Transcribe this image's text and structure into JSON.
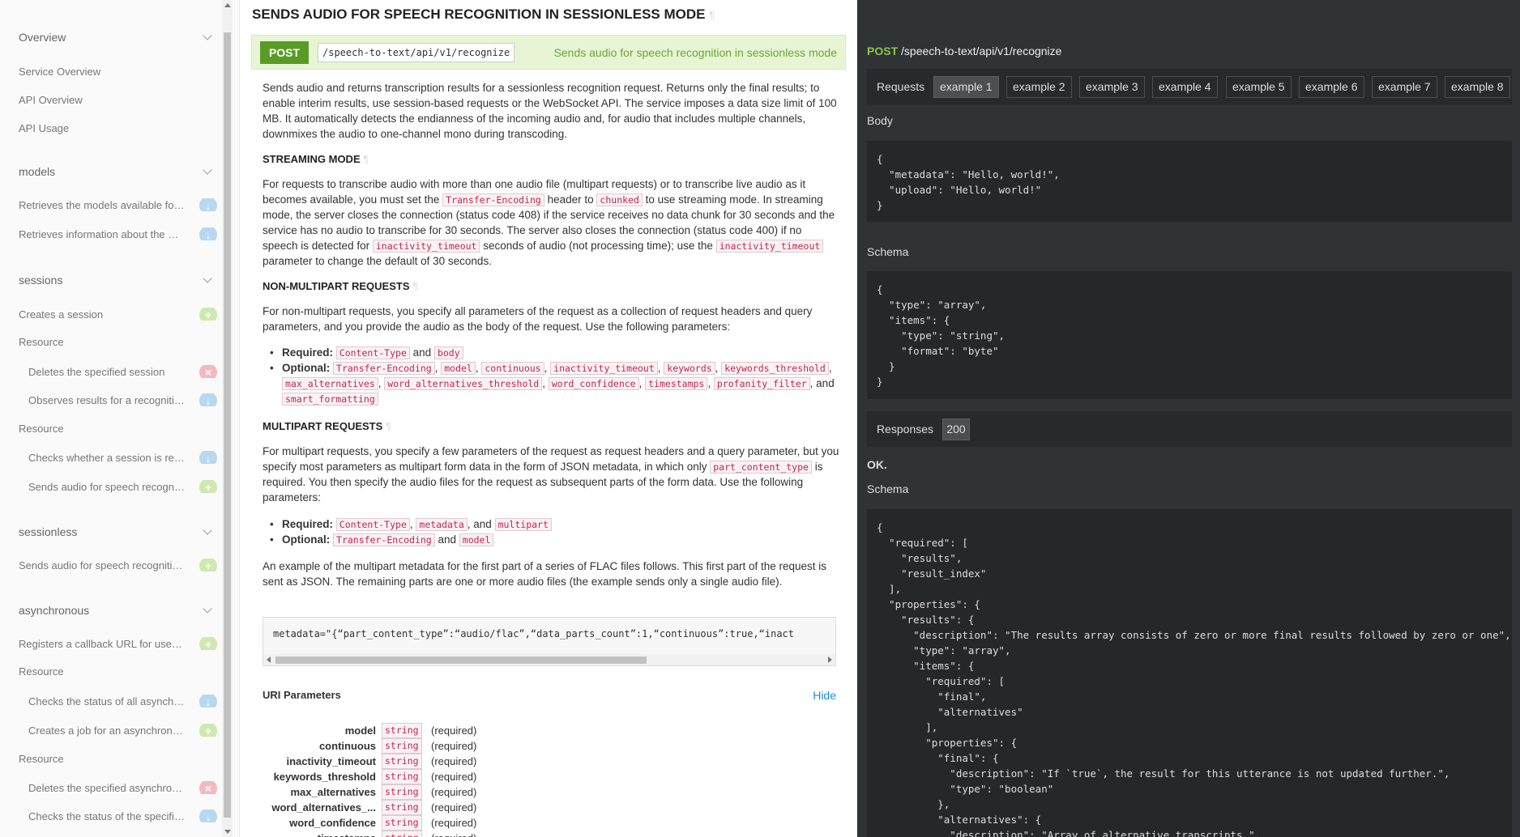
{
  "sidebar": {
    "groups": [
      {
        "title": "Overview",
        "items": [
          "Service Overview",
          "API Overview",
          "API Usage"
        ]
      },
      {
        "title": "models",
        "items": [
          "Retrieves the models available for the service",
          "Retrieves information about the model"
        ]
      },
      {
        "title": "sessions",
        "items": [
          "Creates a session",
          "Deletes the specified session",
          "Observes results for a recognition",
          "Checks whether a session is ready",
          "Sends audio for speech recognition"
        ]
      },
      {
        "title": "sessionless",
        "items": [
          "Sends audio for speech recognition in sessionless mode"
        ]
      },
      {
        "title": "asynchronous",
        "items": [
          "Registers a callback URL for use with",
          "Checks the status of all asynchronous",
          "Creates a job for an asynchronous",
          "Deletes the specified asynchronous",
          "Checks the status of the specified"
        ]
      }
    ],
    "resource_label": "Resource",
    "badge_get": "↓",
    "badge_post": "+",
    "badge_delete": "×"
  },
  "main": {
    "title": "SENDS AUDIO FOR SPEECH RECOGNITION IN SESSIONLESS MODE",
    "pilcrow": "¶",
    "method": "POST",
    "path": "/speech-to-text/api/v1/recognize",
    "summary": "Sends audio for speech recognition in sessionless mode",
    "intro": "Sends audio and returns transcription results for a sessionless recognition request. Returns only the final results; to enable interim results, use session-based requests or the WebSocket API. The service imposes a data size limit of 100 MB. It automatically detects the endianness of the incoming audio and, for audio that includes multiple channels, downmixes the audio to one-channel mono during transcoding.",
    "streaming_heading": "STREAMING MODE",
    "streaming_p1": "For requests to transcribe audio with more than one audio file (multipart requests) or to transcribe live audio as it becomes available, you must set the",
    "streaming_code1": "Transfer-Encoding",
    "streaming_p2": "header to",
    "streaming_code2": "chunked",
    "streaming_p3": "to use streaming mode. In streaming mode, the server closes the connection (status code 408) if the service receives no data chunk for 30 seconds and the service has no audio to transcribe for 30 seconds. The server also closes the connection (status code 400) if no speech is detected for",
    "streaming_code3": "inactivity_timeout",
    "streaming_p4": "seconds of audio (not processing time); use the",
    "streaming_code4": "inactivity_timeout",
    "streaming_p5": "parameter to change the default of 30 seconds.",
    "nonmulti_heading": "NON-MULTIPART REQUESTS",
    "nonmulti_p": "For non-multipart requests, you specify all parameters of the request as a collection of request headers and query parameters, and you provide the audio as the body of the request. Use the following parameters:",
    "required_label": "Required:",
    "optional_label": "Optional:",
    "and": "and",
    "comma_and": ", and",
    "nonmulti_required": [
      "Content-Type",
      "body"
    ],
    "nonmulti_optional": [
      "Transfer-Encoding",
      "model",
      "continuous",
      "inactivity_timeout",
      "keywords",
      "keywords_threshold",
      "max_alternatives",
      "word_alternatives_threshold",
      "word_confidence",
      "timestamps",
      "profanity_filter",
      "smart_formatting"
    ],
    "multi_heading": "MULTIPART REQUESTS",
    "multi_p1": "For multipart requests, you specify a few parameters of the request as request headers and a query parameter, but you specify most parameters as multipart form data in the form of JSON metadata, in which only",
    "multi_code": "part_content_type",
    "multi_p2": "is required. You then specify the audio files for the request as subsequent parts of the form data. Use the following parameters:",
    "multi_required": [
      "Content-Type",
      "metadata",
      "multipart"
    ],
    "multi_optional": [
      "Transfer-Encoding",
      "model"
    ],
    "example_p": "An example of the multipart metadata for the first part of a series of FLAC files follows. This first part of the request is sent as JSON. The remaining parts are one or more audio files (the example sends only a single audio file).",
    "example_code": "metadata=\"{“part_content_type”:“audio/flac”,“data_parts_count”:1,“continuous”:true,“inact",
    "uri_title": "URI Parameters",
    "uri_hide": "Hide",
    "uri_params": [
      "model",
      "continuous",
      "inactivity_timeout",
      "keywords_threshold",
      "max_alternatives",
      "word_alternatives_...",
      "word_confidence",
      "timestamps"
    ],
    "uri_type": "string",
    "uri_required": "(required)"
  },
  "panel": {
    "method": "POST",
    "path": " /speech-to-text/api/v1/recognize",
    "requests_label": "Requests",
    "examples": [
      "example 1",
      "example 2",
      "example 3",
      "example 4",
      "example 5",
      "example 6",
      "example 7",
      "example 8"
    ],
    "body_label": "Body",
    "schema_label": "Schema",
    "responses_label": "Responses",
    "response_code": "200",
    "ok_label": "OK.",
    "body_code": "{\n  \"metadata\": \"Hello, world!\",\n  \"upload\": \"Hello, world!\"\n}",
    "schema_code": "{\n  \"type\": \"array\",\n  \"items\": {\n    \"type\": \"string\",\n    \"format\": \"byte\"\n  }\n}",
    "response_schema_code": "{\n  \"required\": [\n    \"results\",\n    \"result_index\"\n  ],\n  \"properties\": {\n    \"results\": {\n      \"description\": \"The results array consists of zero or more final results followed by zero or one\",\n      \"type\": \"array\",\n      \"items\": {\n        \"required\": [\n          \"final\",\n          \"alternatives\"\n        ],\n        \"properties\": {\n          \"final\": {\n            \"description\": \"If `true`, the result for this utterance is not updated further.\",\n            \"type\": \"boolean\"\n          },\n          \"alternatives\": {\n            \"description\": \"Array of alternative transcripts.\","
  }
}
